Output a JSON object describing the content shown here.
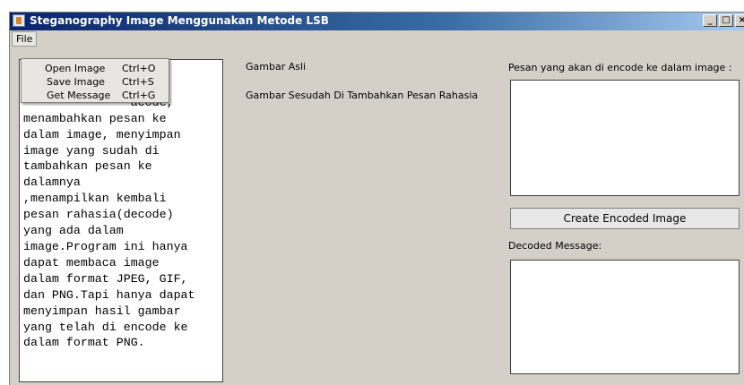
{
  "window": {
    "title": "Steganography Image Menggunakan Metode LSB",
    "buttons": {
      "minimize": "_",
      "maximize": "□",
      "close": "×"
    }
  },
  "menubar": {
    "file": "File"
  },
  "file_menu": {
    "items": [
      {
        "label": "Open Image",
        "shortcut": "Ctrl+O"
      },
      {
        "label": "Save Image",
        "shortcut": "Ctrl+S"
      },
      {
        "label": "Get Message",
        "shortcut": "Ctrl+G"
      }
    ]
  },
  "info_text": "                t di\n               mbuka\n               acode,\nmenambahkan pesan ke\ndalam image, menyimpan\nimage yang sudah di\ntambahkan pesan ke\ndalamnya\n,menampilkan kembali\npesan rahasia(decode)\nyang ada dalam\nimage.Program ini hanya\ndapat membaca image\ndalam format JPEG, GIF,\ndan PNG.Tapi hanya dapat\nmenyimpan hasil gambar\nyang telah di encode ke\ndalam format PNG.",
  "labels": {
    "original_image": "Gambar Asli",
    "encoded_image": "Gambar Sesudah Di Tambahkan Pesan Rahasia",
    "message_prompt": "Pesan yang akan di encode ke dalam image :",
    "decoded_message": "Decoded Message:"
  },
  "inputs": {
    "message_value": "",
    "decoded_value": ""
  },
  "create_button": "Create Encoded Image"
}
